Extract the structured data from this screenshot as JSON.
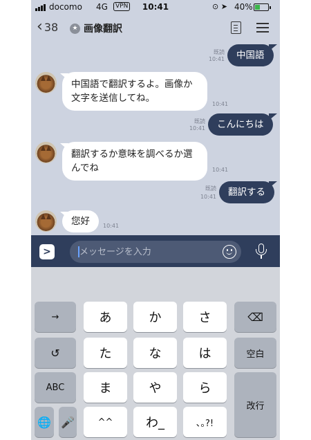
{
  "status_bar": {
    "carrier": "docomo",
    "network": "4G",
    "vpn": "VPN",
    "time": "10:41",
    "battery_percent": "40%",
    "battery_level": 0.4,
    "battery_color": "#3bb54a"
  },
  "header": {
    "back_count": "38",
    "title": "画像翻訳"
  },
  "messages": [
    {
      "dir": "out",
      "text": "中国語",
      "read": "既読",
      "time": "10:41"
    },
    {
      "dir": "in",
      "lines": [
        "中国語で翻訳するよ。画像か",
        "文字を送信してね。"
      ],
      "time": "10:41"
    },
    {
      "dir": "out",
      "text": "こんにちは",
      "read": "既読",
      "time": "10:41"
    },
    {
      "dir": "in",
      "lines": [
        "翻訳するか意味を調べるか選",
        "んでね"
      ],
      "time": "10:41"
    },
    {
      "dir": "out",
      "text": "翻訳する",
      "read": "既読",
      "time": "10:41"
    },
    {
      "dir": "in",
      "text": "您好",
      "time": "10:41"
    }
  ],
  "input_bar": {
    "expand_label": ">",
    "placeholder": "メッセージを入力"
  },
  "keyboard": {
    "row1": [
      "→",
      "あ",
      "か",
      "さ",
      "⌫"
    ],
    "row2": [
      "↺",
      "た",
      "な",
      "は",
      "空白"
    ],
    "row3": [
      "ABC",
      "ま",
      "や",
      "ら",
      "改行"
    ],
    "row4": [
      "🌐",
      "🎤",
      "^^",
      "わ_",
      "､｡?!"
    ]
  },
  "colors": {
    "accent": "#2f3e5c",
    "chat_bg": "#cdd3e0",
    "bubble_in": "#ffffff",
    "keyboard_bg": "#d2d5db"
  }
}
